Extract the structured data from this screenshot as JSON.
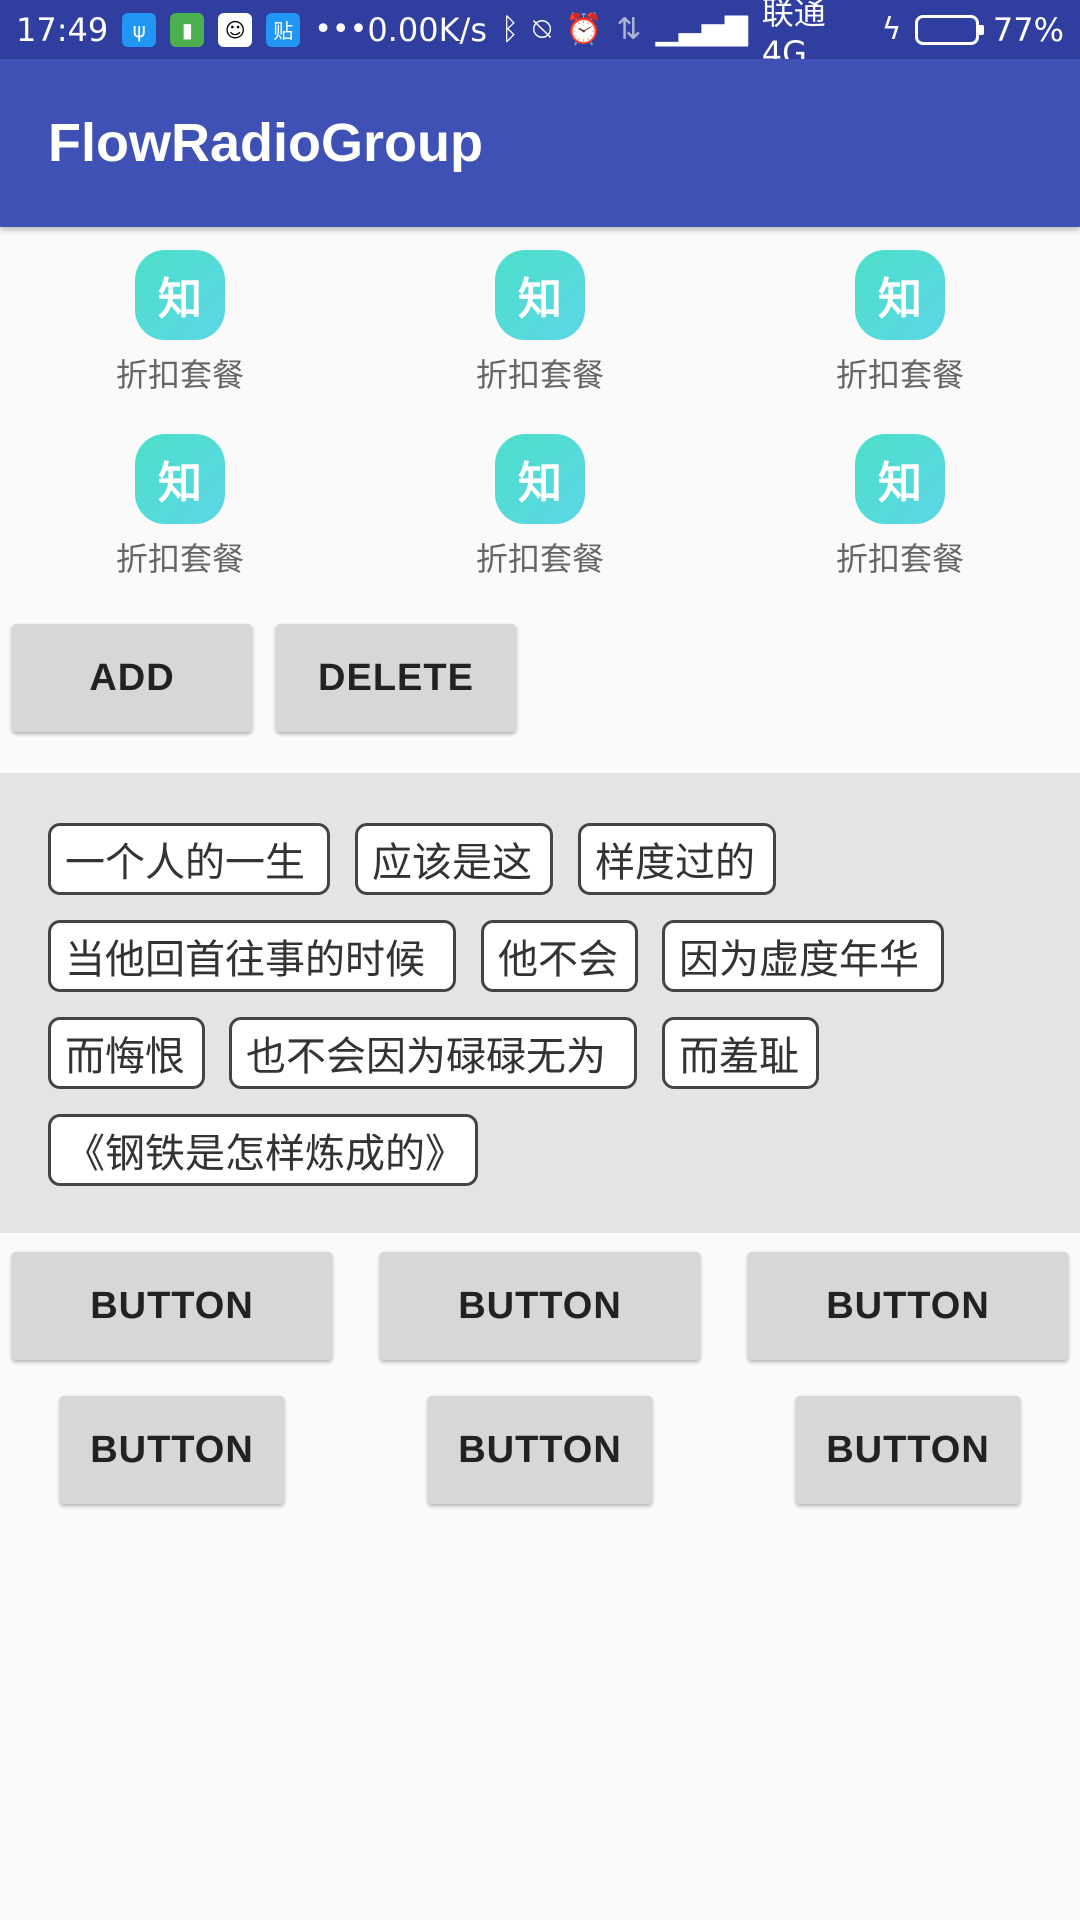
{
  "status_bar": {
    "time": "17:49",
    "net_speed": "0.00K/s",
    "carrier": "联通 4G",
    "battery_percent": "77%",
    "battery_level": 0.77,
    "icons": [
      "usb-icon",
      "battery-app-icon",
      "qq-icon",
      "tieba-icon",
      "more-icon",
      "bluetooth-icon",
      "vibrate-icon",
      "alarm-icon",
      "data-arrows-icon",
      "signal-icon",
      "charging-icon",
      "battery-icon"
    ]
  },
  "app_bar": {
    "title": "FlowRadioGroup"
  },
  "grid": {
    "icon_glyph": "知",
    "items": [
      {
        "label": "折扣套餐"
      },
      {
        "label": "折扣套餐"
      },
      {
        "label": "折扣套餐"
      },
      {
        "label": "折扣套餐"
      },
      {
        "label": "折扣套餐"
      },
      {
        "label": "折扣套餐"
      }
    ]
  },
  "actions": {
    "add": "ADD",
    "delete": "DELETE"
  },
  "tags": [
    "一个人的一生",
    "应该是这",
    "样度过的",
    "当他回首往事的时候",
    "他不会",
    "因为虚度年华",
    "而悔恨",
    "也不会因为碌碌无为",
    "而羞耻",
    "《钢铁是怎样炼成的》"
  ],
  "buttons": [
    "BUTTON",
    "BUTTON",
    "BUTTON",
    "BUTTON",
    "BUTTON",
    "BUTTON"
  ]
}
